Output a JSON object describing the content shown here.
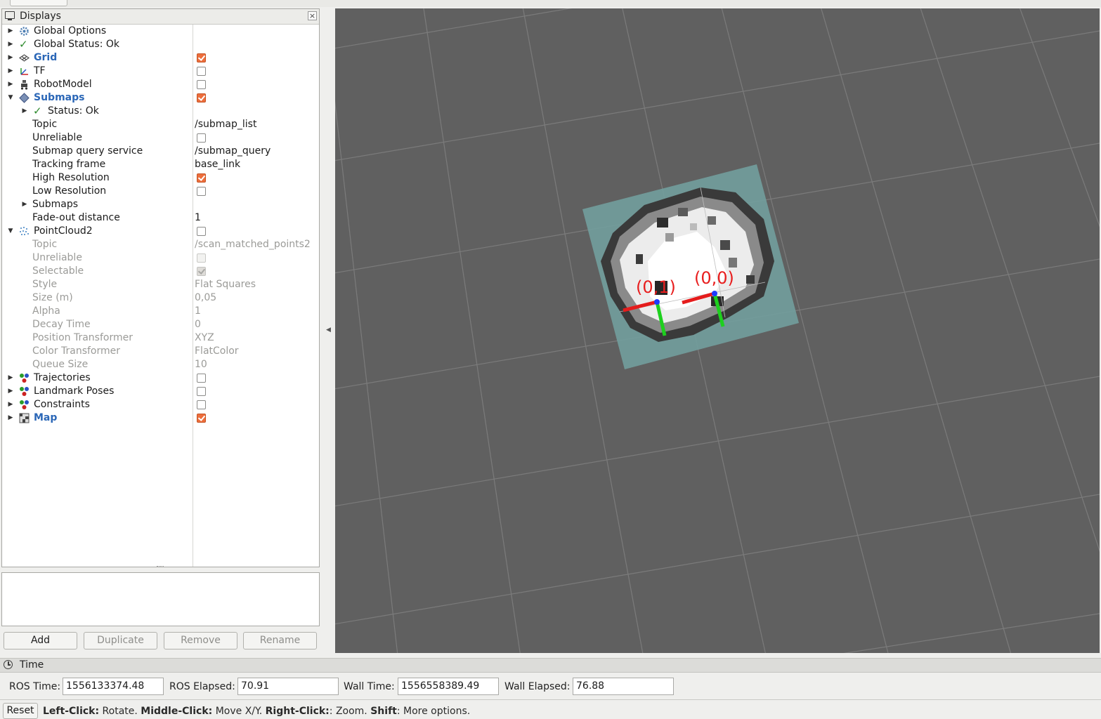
{
  "displays_panel": {
    "title": "Displays",
    "close_label": "×",
    "items": [
      {
        "label": "Global Options"
      },
      {
        "label": "Global Status: Ok"
      },
      {
        "label": "Grid",
        "checked": true
      },
      {
        "label": "TF",
        "checked": false
      },
      {
        "label": "RobotModel",
        "checked": false
      },
      {
        "label": "Submaps",
        "checked": true
      }
    ],
    "submaps_children": {
      "status": "Status: Ok",
      "topic_label": "Topic",
      "topic_value": "/submap_list",
      "unreliable_label": "Unreliable",
      "query_label": "Submap query service",
      "query_value": "/submap_query",
      "tracking_label": "Tracking frame",
      "tracking_value": "base_link",
      "high_res_label": "High Resolution",
      "low_res_label": "Low Resolution",
      "submaps_label": "Submaps",
      "fade_label": "Fade-out distance",
      "fade_value": "1"
    },
    "pointcloud": {
      "label": "PointCloud2",
      "topic_label": "Topic",
      "topic_value": "/scan_matched_points2",
      "unreliable_label": "Unreliable",
      "selectable_label": "Selectable",
      "style_label": "Style",
      "style_value": "Flat Squares",
      "size_label": "Size (m)",
      "size_value": "0,05",
      "alpha_label": "Alpha",
      "alpha_value": "1",
      "decay_label": "Decay Time",
      "decay_value": "0",
      "postrans_label": "Position Transformer",
      "postrans_value": "XYZ",
      "colortrans_label": "Color Transformer",
      "colortrans_value": "FlatColor",
      "queue_label": "Queue Size",
      "queue_value": "10"
    },
    "bottom_items": [
      {
        "label": "Trajectories"
      },
      {
        "label": "Landmark Poses"
      },
      {
        "label": "Constraints"
      },
      {
        "label": "Map"
      }
    ]
  },
  "buttons": {
    "add": "Add",
    "duplicate": "Duplicate",
    "remove": "Remove",
    "rename": "Rename"
  },
  "viewport": {
    "labels": [
      "(0,1)",
      "(0,0)"
    ],
    "grid_color": "#7a7a7a",
    "background": "#606060",
    "submap_tint": "#6f9a9a"
  },
  "time_panel": {
    "title": "Time",
    "ros_time_label": "ROS Time:",
    "ros_time": "1556133374.48",
    "ros_elapsed_label": "ROS Elapsed:",
    "ros_elapsed": "70.91",
    "wall_time_label": "Wall Time:",
    "wall_time": "1556558389.49",
    "wall_elapsed_label": "Wall Elapsed:",
    "wall_elapsed": "76.88"
  },
  "statusbar": {
    "reset": "Reset",
    "left_click": "Left-Click:",
    "rotate": " Rotate. ",
    "middle_click": "Middle-Click:",
    "move": " Move X/Y. ",
    "right_click": "Right-Click:",
    "zoom": ": Zoom. ",
    "shift": "Shift",
    "more": ": More options."
  }
}
